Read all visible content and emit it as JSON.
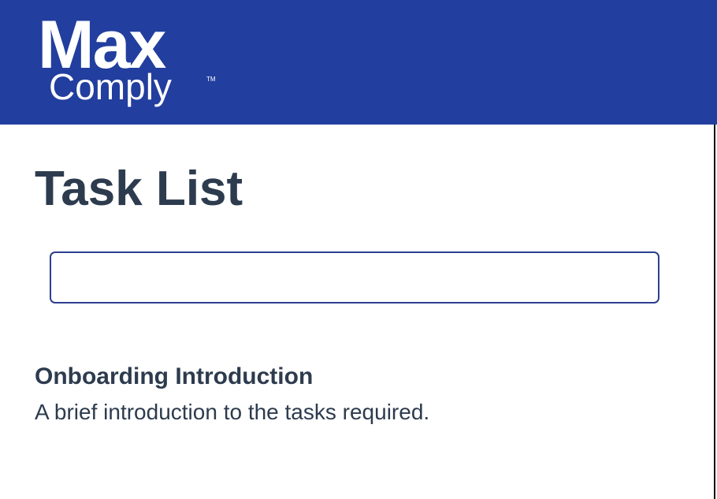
{
  "header": {
    "logo": {
      "word_top": "Max",
      "word_bottom": "Comply",
      "trademark": "TM"
    },
    "background_color": "#223e9e"
  },
  "main": {
    "title": "Task List",
    "search": {
      "value": "",
      "placeholder": ""
    },
    "tasks": [
      {
        "title": "Onboarding Introduction",
        "description": "A brief introduction to the tasks required."
      }
    ]
  },
  "colors": {
    "brand_blue": "#223e9e",
    "text_dark": "#2d3b4e",
    "input_border": "#2c3f8f"
  }
}
